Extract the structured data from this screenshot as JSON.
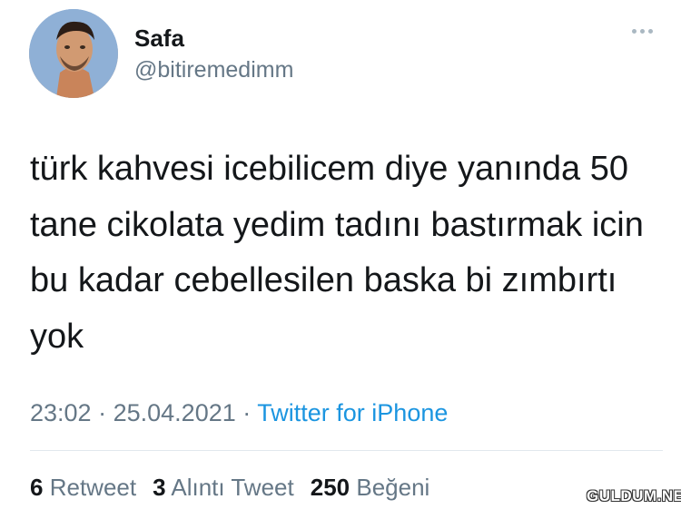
{
  "user": {
    "display_name": "Safa",
    "handle": "@bitiremedimm",
    "avatar_icon": "avatar-photo"
  },
  "header": {
    "more_icon": "more-options-icon"
  },
  "tweet": {
    "text": "türk kahvesi icebilicem diye yanında 50\ntane cikolata yedim tadını bastırmak icin\nbu kadar cebellesilen baska bi zımbırtı\nyok",
    "time": "23:02",
    "separator": "·",
    "date": "25.04.2021",
    "source": "Twitter for iPhone"
  },
  "stats": {
    "retweets_count": "6",
    "retweets_label": "Retweet",
    "quotes_count": "3",
    "quotes_label": "Alıntı Tweet",
    "likes_count": "250",
    "likes_label": "Beğeni"
  },
  "watermark": {
    "text": "GULDUM.NET"
  },
  "colors": {
    "text": "#14171a",
    "secondary": "#657786",
    "link": "#1b95e0",
    "divider": "#e1e8ed"
  }
}
